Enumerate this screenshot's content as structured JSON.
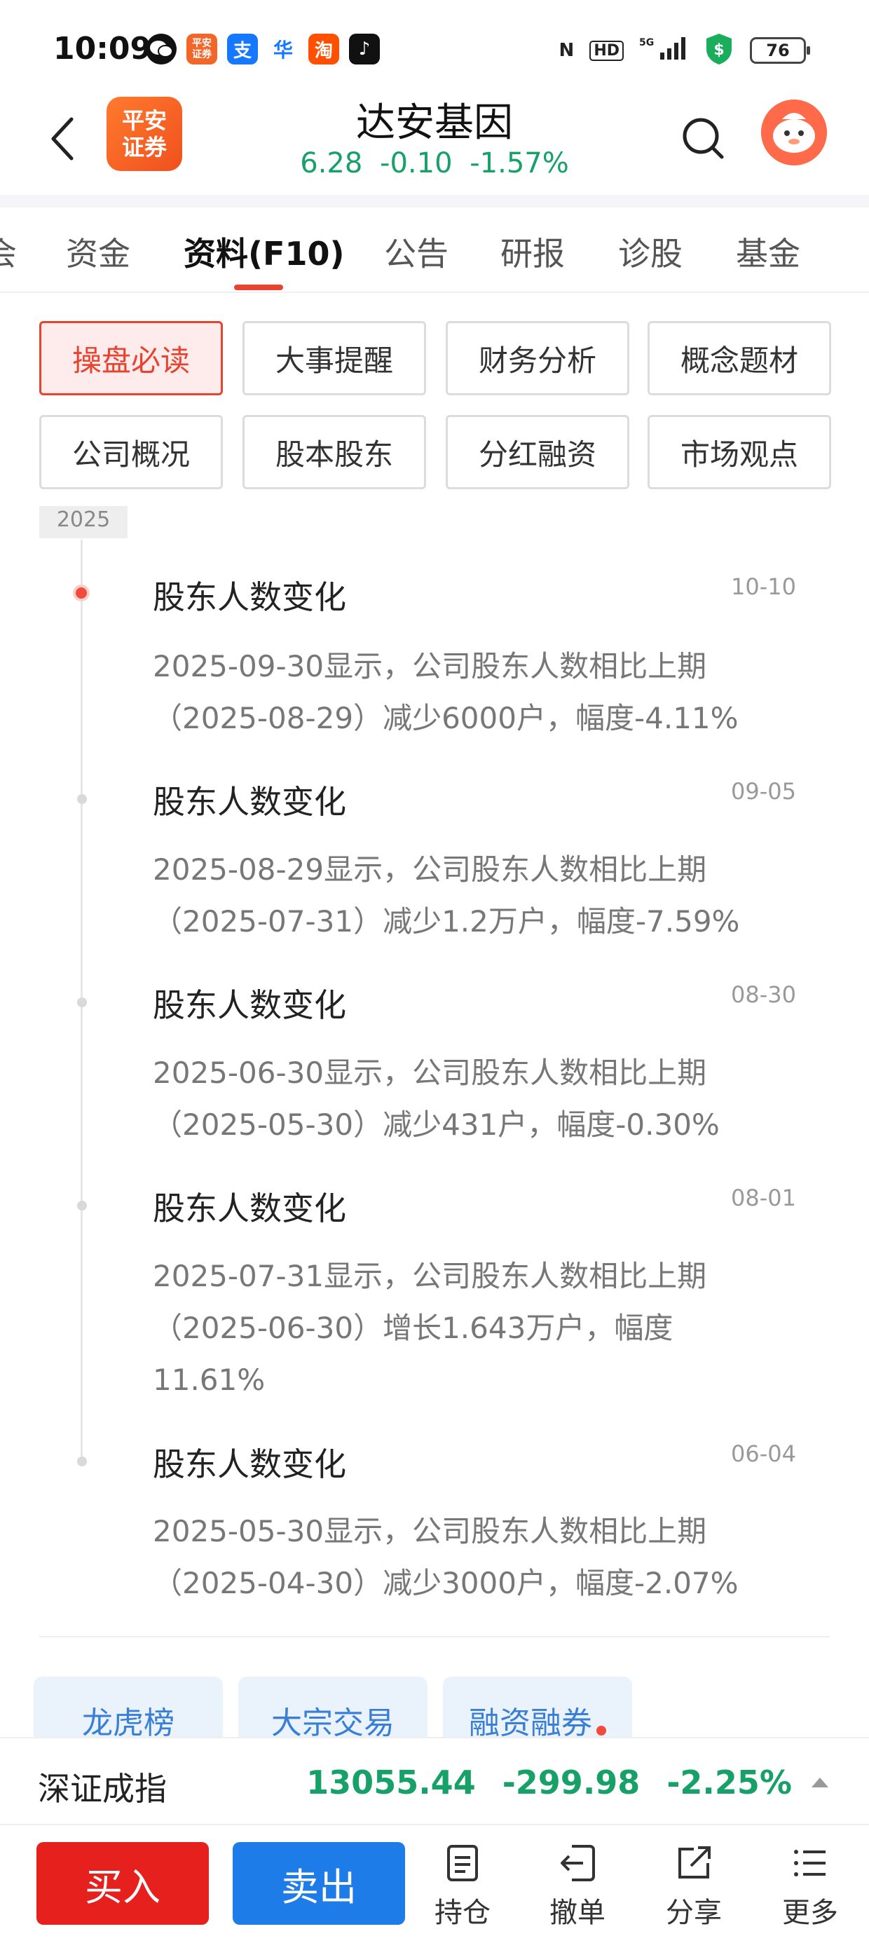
{
  "status_bar": {
    "time": "10:09",
    "icons": [
      "wechat-icon",
      "pingan-icon",
      "alipay-icon",
      "app-icon",
      "taobao-icon",
      "tiktok-icon"
    ],
    "battery": "76"
  },
  "header": {
    "logo_line1": "平安",
    "logo_line2": "证券",
    "stock_name": "达安基因",
    "price": "6.28",
    "change": "-0.10",
    "change_pct": "-1.57%"
  },
  "tabs": [
    "会",
    "资金",
    "资料(F10)",
    "公告",
    "研报",
    "诊股",
    "基金"
  ],
  "active_tab": 2,
  "grid_buttons": [
    "操盘必读",
    "大事提醒",
    "财务分析",
    "概念题材",
    "公司概况",
    "股本股东",
    "分红融资",
    "市场观点"
  ],
  "active_grid": 0,
  "timeline": {
    "year": "2025",
    "events": [
      {
        "title": "股东人数变化",
        "date": "10-10",
        "line1": "2025-09-30显示，公司股东人数相比上期",
        "line2": "（2025-08-29）减少6000户，幅度-4.11%",
        "line3": ""
      },
      {
        "title": "股东人数变化",
        "date": "09-05",
        "line1": "2025-08-29显示，公司股东人数相比上期",
        "line2": "（2025-07-31）减少1.2万户，幅度-7.59%",
        "line3": ""
      },
      {
        "title": "股东人数变化",
        "date": "08-30",
        "line1": "2025-06-30显示，公司股东人数相比上期",
        "line2": "（2025-05-30）减少431户，幅度-0.30%",
        "line3": ""
      },
      {
        "title": "股东人数变化",
        "date": "08-01",
        "line1": "2025-07-31显示，公司股东人数相比上期",
        "line2": "（2025-06-30）增长1.643万户，幅度",
        "line3": "11.61%"
      },
      {
        "title": "股东人数变化",
        "date": "06-04",
        "line1": "2025-05-30显示，公司股东人数相比上期",
        "line2": "（2025-04-30）减少3000户，幅度-2.07%",
        "line3": ""
      }
    ]
  },
  "chips": [
    "龙虎榜",
    "大宗交易",
    "融资融券"
  ],
  "index_bar": {
    "name": "深证成指",
    "value": "13055.44",
    "change": "-299.98",
    "change_pct": "-2.25%"
  },
  "bottom_bar": {
    "buy": "买入",
    "sell": "卖出",
    "items": [
      "持仓",
      "撤单",
      "分享",
      "更多"
    ]
  },
  "colors": {
    "accent_red": "#e8432e",
    "price_green": "#17a068",
    "buy_red": "#e5201d",
    "sell_blue": "#1e7ce8",
    "chip_blue": "#3a7fd6"
  }
}
